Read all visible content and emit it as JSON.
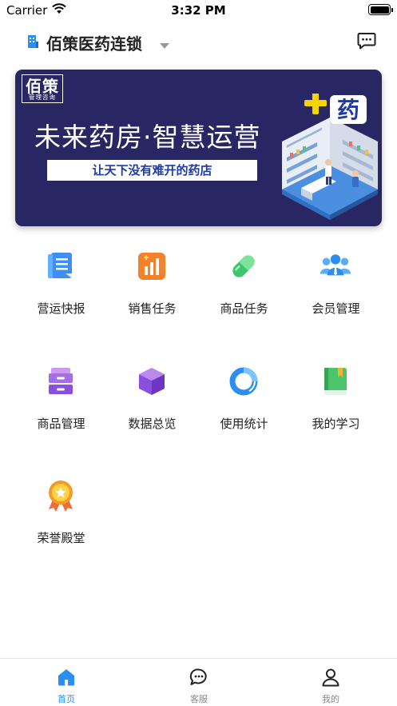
{
  "status_bar": {
    "carrier": "Carrier",
    "time": "3:32 PM"
  },
  "header": {
    "title": "佰策医药连锁"
  },
  "banner": {
    "logo_main": "佰策",
    "logo_sub": "管理咨询",
    "slogan": "未来药房·智慧运营",
    "tagline": "让天下没有难开的药店",
    "art_badge": "药"
  },
  "menu": {
    "items": [
      {
        "label": "营运快报",
        "icon": "report-icon"
      },
      {
        "label": "销售任务",
        "icon": "sales-chart-icon"
      },
      {
        "label": "商品任务",
        "icon": "capsule-icon"
      },
      {
        "label": "会员管理",
        "icon": "members-icon"
      },
      {
        "label": "商品管理",
        "icon": "cabinet-icon"
      },
      {
        "label": "数据总览",
        "icon": "cube-icon"
      },
      {
        "label": "使用统计",
        "icon": "donut-chart-icon"
      },
      {
        "label": "我的学习",
        "icon": "book-icon"
      },
      {
        "label": "荣誉殿堂",
        "icon": "medal-icon"
      }
    ]
  },
  "tab_bar": {
    "tabs": [
      {
        "label": "首页",
        "icon": "home-icon",
        "active": true
      },
      {
        "label": "客服",
        "icon": "chat-icon",
        "active": false
      },
      {
        "label": "我的",
        "icon": "user-icon",
        "active": false
      }
    ]
  },
  "colors": {
    "accent": "#2a8ff0",
    "banner_bg": "#282763",
    "tagline_text": "#1d3aa6"
  }
}
